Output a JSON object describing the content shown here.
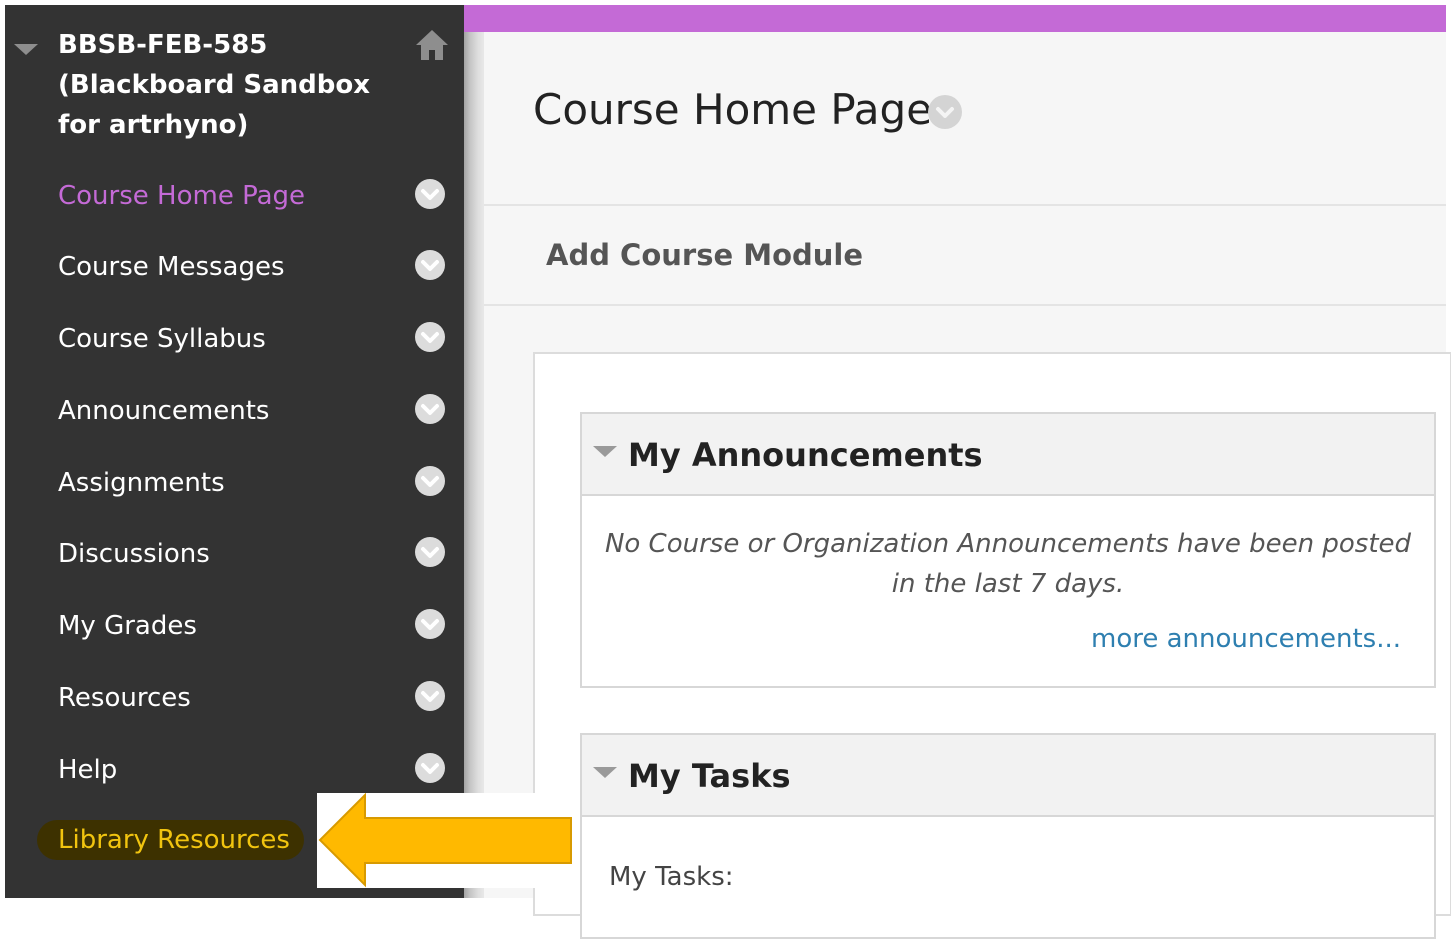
{
  "sidebar": {
    "course_title": "BBSB-FEB-585 (Blackboard Sandbox for artrhyno)",
    "home_icon": "home-icon",
    "items": [
      {
        "label": "Course Home Page",
        "active": true
      },
      {
        "label": "Course Messages"
      },
      {
        "label": "Course Syllabus"
      },
      {
        "label": "Announcements"
      },
      {
        "label": "Assignments"
      },
      {
        "label": "Discussions"
      },
      {
        "label": "My Grades"
      },
      {
        "label": "Resources"
      },
      {
        "label": "Help"
      }
    ],
    "highlighted_item": {
      "label": "Library Resources"
    }
  },
  "main": {
    "page_title": "Course Home Page",
    "add_module_label": "Add Course Module",
    "announcements": {
      "title": "My Announcements",
      "empty_message": "No Course or Organization Announcements have been posted in the last 7 days.",
      "more_link": "more announcements..."
    },
    "tasks": {
      "title": "My Tasks",
      "body_label": "My Tasks:"
    }
  },
  "colors": {
    "accent": "#c46ad6",
    "sidebar_bg": "#333333",
    "highlight_text": "#f1c40f",
    "arrow": "#ffb900",
    "link": "#2e7fb0"
  }
}
